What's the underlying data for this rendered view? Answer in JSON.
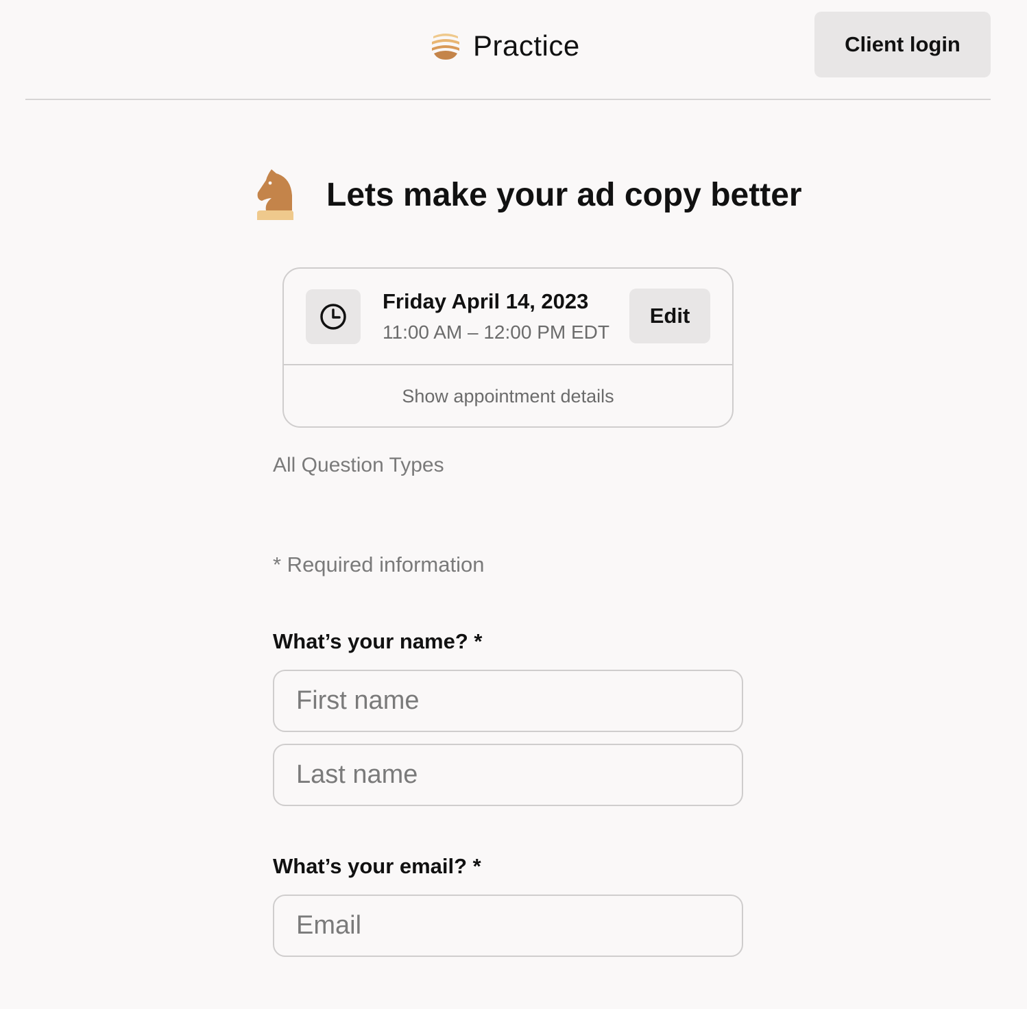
{
  "header": {
    "brand_name": "Practice",
    "login_label": "Client login"
  },
  "page": {
    "title": "Lets make your ad copy better"
  },
  "appointment": {
    "date": "Friday April 14, 2023",
    "time": "11:00 AM – 12:00 PM EDT",
    "edit_label": "Edit",
    "details_label": "Show appointment details"
  },
  "form": {
    "section_label": "All Question Types",
    "required_note": "* Required information",
    "name_question": "What’s your name? *",
    "first_name_placeholder": "First name",
    "last_name_placeholder": "Last name",
    "email_question": "What’s your email? *",
    "email_placeholder": "Email"
  },
  "colors": {
    "logo_orange": "#c4844a",
    "logo_light": "#efc98c",
    "background": "#faf8f8",
    "button_bg": "#e8e6e6"
  },
  "icons": [
    "practice-logo-icon",
    "knight-icon",
    "clock-icon"
  ]
}
